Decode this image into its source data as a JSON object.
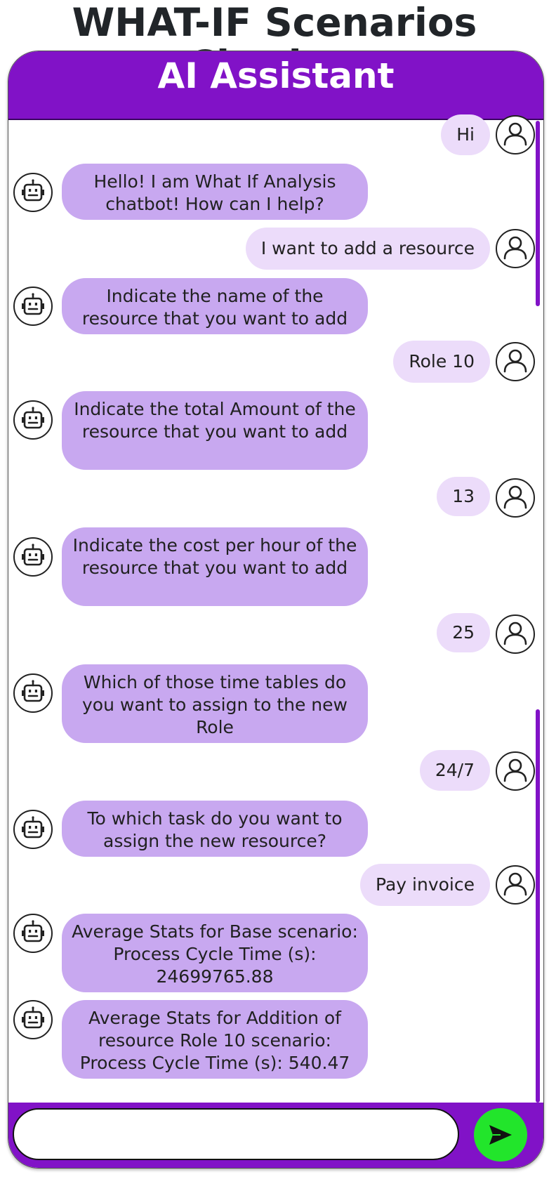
{
  "page": {
    "title": "WHAT-IF Scenarios Chatbot"
  },
  "chat": {
    "header_title": "AI Assistant",
    "messages": [
      {
        "sender": "user",
        "text": "Hi"
      },
      {
        "sender": "bot",
        "text": "Hello! I am What If Analysis chatbot! How can I help?"
      },
      {
        "sender": "user",
        "text": "I want to add a resource"
      },
      {
        "sender": "bot",
        "text": "Indicate the name of the resource that you want to add"
      },
      {
        "sender": "user",
        "text": "Role 10"
      },
      {
        "sender": "bot",
        "text": "Indicate the total Amount of the resource that you want to add"
      },
      {
        "sender": "user",
        "text": "13"
      },
      {
        "sender": "bot",
        "text": "Indicate the cost per hour of the resource that you want to add"
      },
      {
        "sender": "user",
        "text": "25"
      },
      {
        "sender": "bot",
        "text": "Which of those time tables do you want to assign to the new Role"
      },
      {
        "sender": "user",
        "text": "24/7"
      },
      {
        "sender": "bot",
        "text": "To which task do you want to assign the new resource?"
      },
      {
        "sender": "user",
        "text": "Pay invoice"
      },
      {
        "sender": "bot",
        "text": "Average Stats for Base scenario: Process Cycle Time (s): 24699765.88"
      },
      {
        "sender": "bot",
        "text": "Average Stats for Addition of resource Role 10 scenario: Process Cycle Time (s): 540.47"
      }
    ],
    "input": {
      "value": "",
      "placeholder": ""
    }
  },
  "icons": {
    "user_avatar": "user-avatar-icon",
    "bot_avatar": "robot-icon",
    "send": "send-icon"
  },
  "colors": {
    "accent": "#8112c7",
    "bot_bubble": "#c8a8f0",
    "user_bubble": "#ecdcfa",
    "send_button": "#22e52b"
  }
}
